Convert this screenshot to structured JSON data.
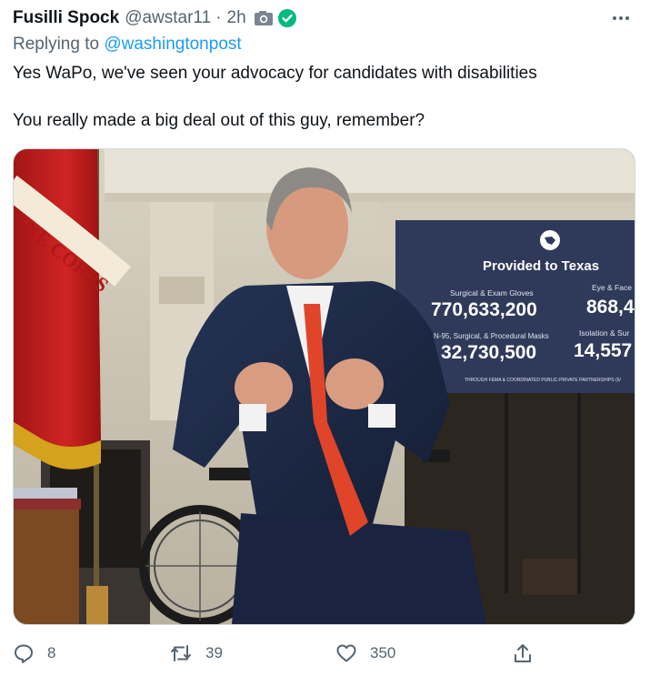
{
  "author": {
    "name": "Fusilli Spock",
    "handle": "@awstar11",
    "separator": "·",
    "time": "2h"
  },
  "reply": {
    "prefix": "Replying to",
    "mention": "@washingtonpost"
  },
  "tweet_text": {
    "line1": "Yes WaPo, we've seen your advocacy for candidates with disabilities",
    "line2": "You really made a big deal out of this guy, remember?"
  },
  "media": {
    "flag_text": "NE CORPS",
    "sign": {
      "title": "Provided to Texas",
      "items": [
        {
          "label": "Surgical & Exam Gloves",
          "value": "770,633,200"
        },
        {
          "label": "Eye & Face S",
          "value": "868,4"
        },
        {
          "label": "N-95, Surgical, & Procedural Masks",
          "value": "32,730,500"
        },
        {
          "label": "Isolation & Sur",
          "value": "14,557"
        }
      ],
      "footer": "THROUGH FEMA & COORDINATED PUBLIC-PRIVATE PARTNERSHIPS (5/"
    }
  },
  "actions": {
    "replies": "8",
    "retweets": "39",
    "likes": "350"
  },
  "colors": {
    "link": "#1d9bf0",
    "muted": "#536471",
    "verified": "#00ba7c",
    "sign_bg": "#2f3a5a"
  }
}
